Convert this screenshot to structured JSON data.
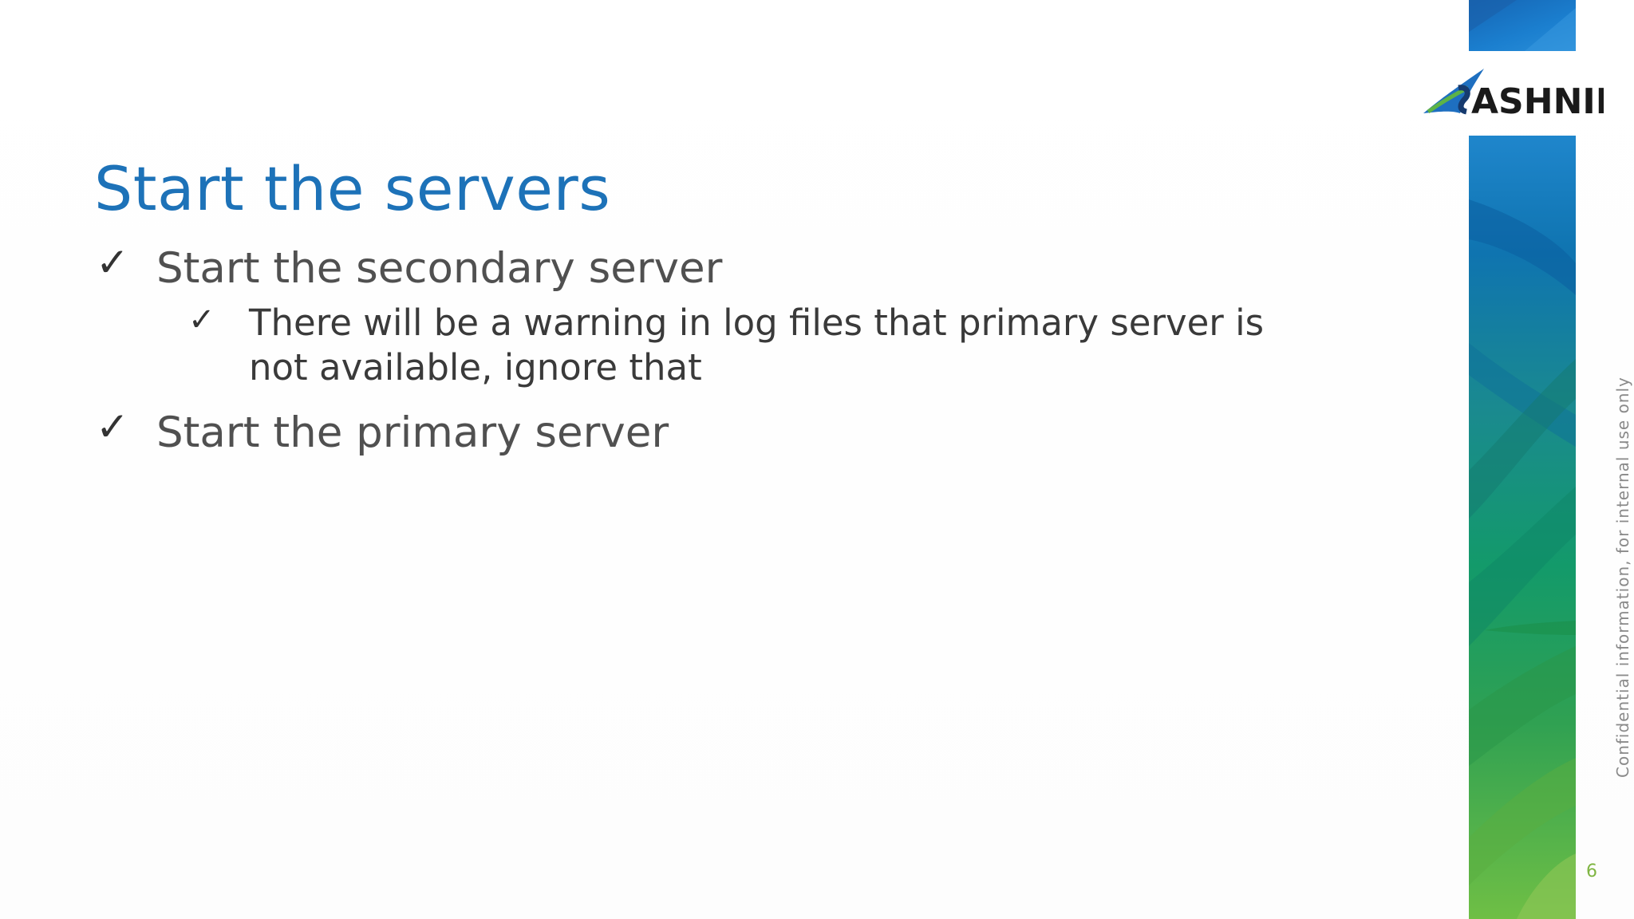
{
  "slide": {
    "title": "Start the servers",
    "bullets": [
      {
        "check": "✓",
        "text": "Start the secondary server"
      },
      {
        "check": "✓",
        "text": "There will be a warning in log files that primary server is not available, ignore that"
      },
      {
        "check": "✓",
        "text": "Start the primary server"
      }
    ],
    "logo_text": "ASHNIK",
    "side_note": "Confidential information, for internal use only",
    "page_number": "6"
  },
  "colors": {
    "title": "#1d72b8",
    "band_top": "#1565b4",
    "band_bottom": "#6fbf45",
    "page_number": "#7fb542"
  }
}
